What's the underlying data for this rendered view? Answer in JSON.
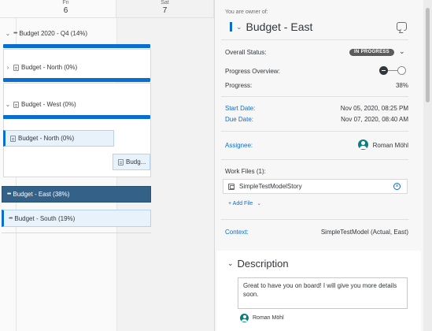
{
  "calendar": {
    "days": [
      {
        "weekday": "Fri",
        "day": "6"
      },
      {
        "weekday": "Sat",
        "day": "7"
      }
    ]
  },
  "tree": {
    "parent": {
      "chevron": "chevron-down-icon",
      "label": "Budget 2020 - Q4 (14%)"
    },
    "north": {
      "chevron": "chevron-right-icon",
      "label": "Budget - North (0%)"
    },
    "west": {
      "chevron": "chevron-down-icon",
      "label": "Budget - West (0%)"
    }
  },
  "bars": {
    "north_bar": "Budget - North (0%)",
    "small_bar": "Budg...",
    "east_bar": "Budget - East (38%)",
    "south_bar": "Budget - South (19%)"
  },
  "detail": {
    "owner_text": "You are owner of:",
    "title": "Budget - East",
    "status_label": "Overall Status:",
    "status_badge": "IN PROGRESS",
    "progress_overview_label": "Progress Overview:",
    "progress_label": "Progress:",
    "progress_value": "38%",
    "start_label": "Start Date:",
    "start_value": "Nov 05, 2020, 08:25 PM",
    "due_label": "Due Date:",
    "due_value": "Nov 07, 2020, 08:40 AM",
    "assignee_label": "Assignee:",
    "assignee_value": "Roman Möhl",
    "work_files_label": "Work Files (1):",
    "file_name": "SimpleTestModelStory",
    "add_file": "+ Add File",
    "context_label": "Context:",
    "context_value": "SimpleTestModel (Actual, East)",
    "description_title": "Description",
    "description_text": "Great to have you on board! I will give you more details soon.",
    "comment_author": "Roman Möhl"
  },
  "colors": {
    "accent": "#0a6ed1",
    "selected_bar": "#346187",
    "avatar": "#107e7d",
    "status_badge": "#5b5b5b"
  }
}
